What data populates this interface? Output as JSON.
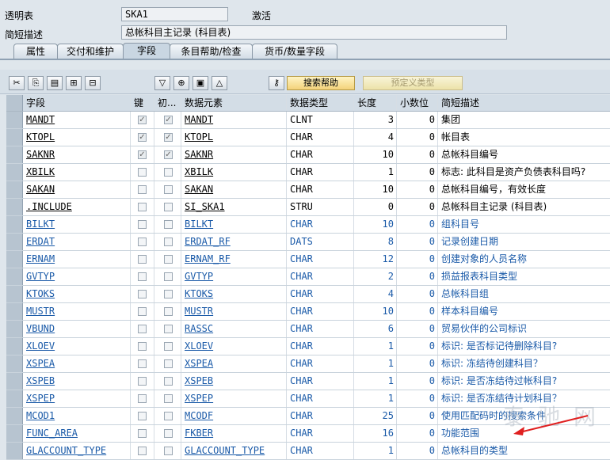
{
  "header": {
    "table_label": "透明表",
    "table_value": "SKA1",
    "status": "激活",
    "desc_label": "简短描述",
    "desc_value": "总帐科目主记录 (科目表)"
  },
  "tabs": [
    "属性",
    "交付和维护",
    "字段",
    "条目帮助/检查",
    "货币/数量字段"
  ],
  "active_tab": 2,
  "toolbar": {
    "search_help_label": "搜索帮助",
    "predefined_type_label": "预定义类型",
    "icons": [
      "scissors-icon",
      "copy-icon",
      "paste-icon",
      "insert-row-icon",
      "delete-row-icon",
      "filter-icon",
      "insert-icon",
      "append-icon",
      "sort-icon",
      "key-icon"
    ]
  },
  "columns": [
    "字段",
    "键",
    "初...",
    "数据元素",
    "数据类型",
    "长度",
    "小数位",
    "简短描述"
  ],
  "rows": [
    {
      "field": "MANDT",
      "key": true,
      "init": true,
      "elem": "MANDT",
      "type": "CLNT",
      "len": "3",
      "dec": "0",
      "desc": "集团",
      "inc": false
    },
    {
      "field": "KTOPL",
      "key": true,
      "init": true,
      "elem": "KTOPL",
      "type": "CHAR",
      "len": "4",
      "dec": "0",
      "desc": "帐目表",
      "inc": false
    },
    {
      "field": "SAKNR",
      "key": true,
      "init": true,
      "elem": "SAKNR",
      "type": "CHAR",
      "len": "10",
      "dec": "0",
      "desc": "总帐科目编号",
      "inc": false
    },
    {
      "field": "XBILK",
      "key": false,
      "init": false,
      "elem": "XBILK",
      "type": "CHAR",
      "len": "1",
      "dec": "0",
      "desc": "标志: 此科目是资产负债表科目吗?",
      "inc": false
    },
    {
      "field": "SAKAN",
      "key": false,
      "init": false,
      "elem": "SAKAN",
      "type": "CHAR",
      "len": "10",
      "dec": "0",
      "desc": "总帐科目编号，有效长度",
      "inc": false
    },
    {
      "field": ".INCLUDE",
      "key": false,
      "init": false,
      "elem": "SI_SKA1",
      "type": "STRU",
      "len": "0",
      "dec": "0",
      "desc": "总帐科目主记录 (科目表)",
      "inc": false
    },
    {
      "field": "BILKT",
      "key": false,
      "init": false,
      "elem": "BILKT",
      "type": "CHAR",
      "len": "10",
      "dec": "0",
      "desc": "组科目号",
      "inc": true
    },
    {
      "field": "ERDAT",
      "key": false,
      "init": false,
      "elem": "ERDAT_RF",
      "type": "DATS",
      "len": "8",
      "dec": "0",
      "desc": "记录创建日期",
      "inc": true
    },
    {
      "field": "ERNAM",
      "key": false,
      "init": false,
      "elem": "ERNAM_RF",
      "type": "CHAR",
      "len": "12",
      "dec": "0",
      "desc": "创建对象的人员名称",
      "inc": true
    },
    {
      "field": "GVTYP",
      "key": false,
      "init": false,
      "elem": "GVTYP",
      "type": "CHAR",
      "len": "2",
      "dec": "0",
      "desc": "损益报表科目类型",
      "inc": true
    },
    {
      "field": "KTOKS",
      "key": false,
      "init": false,
      "elem": "KTOKS",
      "type": "CHAR",
      "len": "4",
      "dec": "0",
      "desc": "总帐科目组",
      "inc": true
    },
    {
      "field": "MUSTR",
      "key": false,
      "init": false,
      "elem": "MUSTR",
      "type": "CHAR",
      "len": "10",
      "dec": "0",
      "desc": "样本科目编号",
      "inc": true
    },
    {
      "field": "VBUND",
      "key": false,
      "init": false,
      "elem": "RASSC",
      "type": "CHAR",
      "len": "6",
      "dec": "0",
      "desc": "贸易伙伴的公司标识",
      "inc": true
    },
    {
      "field": "XLOEV",
      "key": false,
      "init": false,
      "elem": "XLOEV",
      "type": "CHAR",
      "len": "1",
      "dec": "0",
      "desc": "标识: 是否标记待删除科目?",
      "inc": true
    },
    {
      "field": "XSPEA",
      "key": false,
      "init": false,
      "elem": "XSPEA",
      "type": "CHAR",
      "len": "1",
      "dec": "0",
      "desc": "标识: 冻结待创建科目？",
      "inc": true
    },
    {
      "field": "XSPEB",
      "key": false,
      "init": false,
      "elem": "XSPEB",
      "type": "CHAR",
      "len": "1",
      "dec": "0",
      "desc": "标识: 是否冻结待过帐科目?",
      "inc": true
    },
    {
      "field": "XSPEP",
      "key": false,
      "init": false,
      "elem": "XSPEP",
      "type": "CHAR",
      "len": "1",
      "dec": "0",
      "desc": "标识: 是否冻结待计划科目？",
      "inc": true
    },
    {
      "field": "MCOD1",
      "key": false,
      "init": false,
      "elem": "MCODF",
      "type": "CHAR",
      "len": "25",
      "dec": "0",
      "desc": "使用匹配码时的搜索条件",
      "inc": true
    },
    {
      "field": "FUNC_AREA",
      "key": false,
      "init": false,
      "elem": "FKBER",
      "type": "CHAR",
      "len": "16",
      "dec": "0",
      "desc": "功能范围",
      "inc": true
    },
    {
      "field": "GLACCOUNT_TYPE",
      "key": false,
      "init": false,
      "elem": "GLACCOUNT_TYPE",
      "type": "CHAR",
      "len": "1",
      "dec": "0",
      "desc": "总帐科目的类型",
      "inc": true
    }
  ],
  "watermark": "泰 驰 网"
}
